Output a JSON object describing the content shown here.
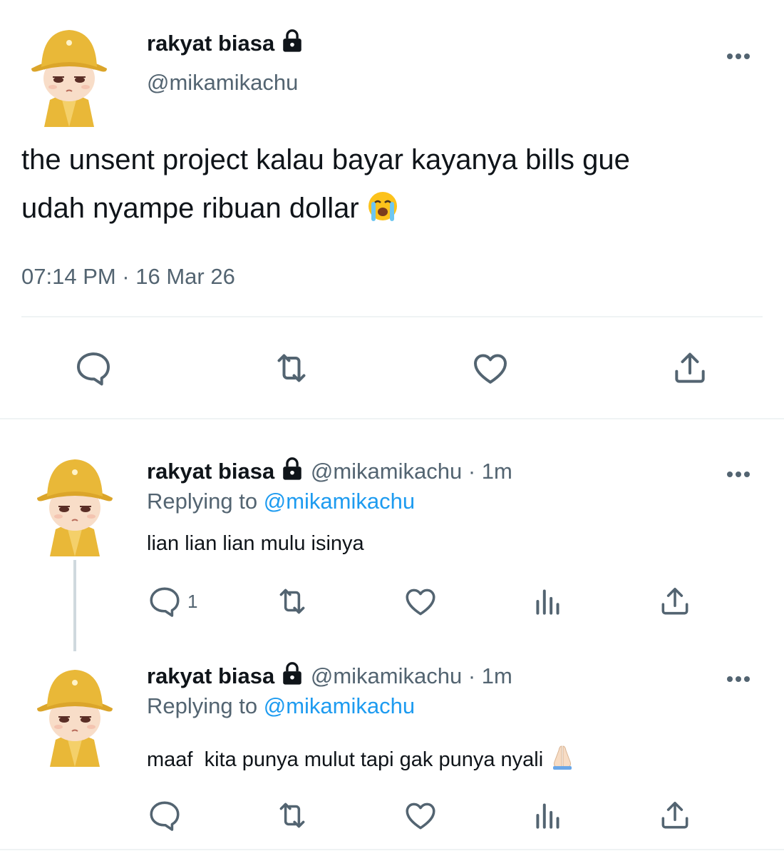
{
  "main_tweet": {
    "display_name": "rakyat biasa",
    "handle": "@mikamikachu",
    "text_line1": "the unsent project kalau bayar kayanya bills gue",
    "text_line2": "udah nyampe ribuan dollar",
    "timestamp": "07:14 PM · 16 Mar 26"
  },
  "replies": [
    {
      "display_name": "rakyat biasa",
      "handle_time": "@mikamikachu · 1m",
      "replying_label": "Replying to",
      "replying_handle": "@mikamikachu",
      "text": "lian lian lian mulu isinya",
      "reply_count": "1"
    },
    {
      "display_name": "rakyat biasa",
      "handle_time": "@mikamikachu · 1m",
      "replying_label": "Replying to",
      "replying_handle": "@mikamikachu",
      "text": "maaf  kita punya mulut tapi gak punya nyali",
      "reply_count": ""
    }
  ],
  "icons": {
    "reply": "comment-bubble-icon",
    "retweet": "retweet-icon",
    "like": "heart-icon",
    "views": "bar-chart-icon",
    "share": "share-upload-icon",
    "more": "more-dots-icon",
    "lock": "lock-icon"
  },
  "colors": {
    "text": "#0f1419",
    "secondary": "#536471",
    "link": "#1d9bf0",
    "avatar_hat": "#e9b838"
  }
}
